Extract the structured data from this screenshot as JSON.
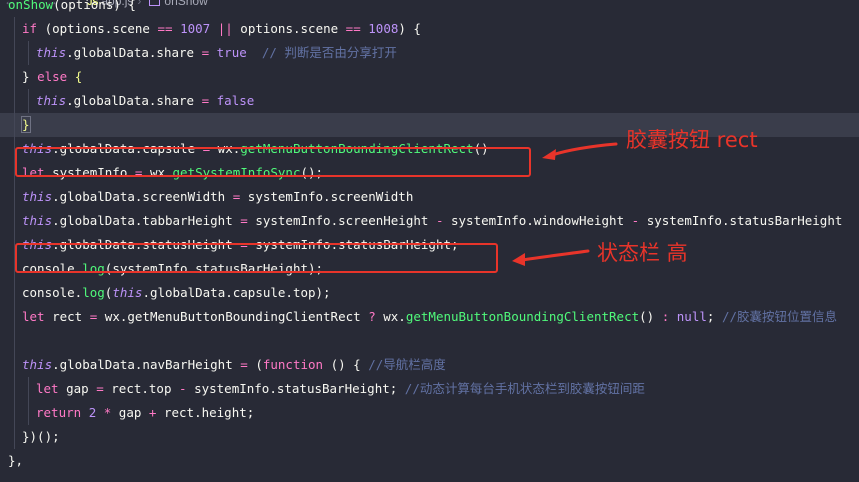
{
  "breadcrumb": {
    "file": "app.js",
    "symbol": "onShow",
    "js_badge": "JS"
  },
  "code_lines": [
    {
      "indent": 0,
      "hl": false,
      "tokens": [
        [
          "fn",
          "onShow"
        ],
        [
          "txt",
          "(options) {"
        ]
      ]
    },
    {
      "indent": 1,
      "hl": false,
      "tokens": [
        [
          "kw",
          "if"
        ],
        [
          "txt",
          " (options.scene "
        ],
        [
          "op",
          "=="
        ],
        [
          "txt",
          " "
        ],
        [
          "num",
          "1007"
        ],
        [
          "txt",
          " "
        ],
        [
          "op",
          "||"
        ],
        [
          "txt",
          " options.scene "
        ],
        [
          "op",
          "=="
        ],
        [
          "txt",
          " "
        ],
        [
          "num",
          "1008"
        ],
        [
          "txt",
          ") {"
        ]
      ]
    },
    {
      "indent": 2,
      "hl": false,
      "tokens": [
        [
          "this",
          "this"
        ],
        [
          "txt",
          ".globalData.share "
        ],
        [
          "op",
          "="
        ],
        [
          "txt",
          " "
        ],
        [
          "bool",
          "true"
        ],
        [
          "txt",
          "  "
        ],
        [
          "cm",
          "// 判断是否由分享打开"
        ]
      ]
    },
    {
      "indent": 1,
      "hl": false,
      "tokens": [
        [
          "txt",
          "} "
        ],
        [
          "kw",
          "else"
        ],
        [
          "txt",
          " "
        ],
        [
          "br",
          "{"
        ]
      ]
    },
    {
      "indent": 2,
      "hl": false,
      "tokens": [
        [
          "this",
          "this"
        ],
        [
          "txt",
          ".globalData.share "
        ],
        [
          "op",
          "="
        ],
        [
          "txt",
          " "
        ],
        [
          "bool",
          "false"
        ]
      ]
    },
    {
      "indent": 1,
      "hl": true,
      "tokens": [
        [
          "brm",
          "}"
        ]
      ]
    },
    {
      "indent": 1,
      "hl": false,
      "tokens": [
        [
          "this",
          "this"
        ],
        [
          "txt",
          ".globalData.capsule "
        ],
        [
          "op",
          "="
        ],
        [
          "txt",
          " wx."
        ],
        [
          "fn",
          "getMenuButtonBoundingClientRect"
        ],
        [
          "txt",
          "()"
        ]
      ]
    },
    {
      "indent": 1,
      "hl": false,
      "tokens": [
        [
          "kw",
          "let"
        ],
        [
          "txt",
          " systemInfo "
        ],
        [
          "op",
          "="
        ],
        [
          "txt",
          " wx."
        ],
        [
          "fn",
          "getSystemInfoSync"
        ],
        [
          "txt",
          "();"
        ]
      ]
    },
    {
      "indent": 1,
      "hl": false,
      "tokens": [
        [
          "this",
          "this"
        ],
        [
          "txt",
          ".globalData.screenWidth "
        ],
        [
          "op",
          "="
        ],
        [
          "txt",
          " systemInfo.screenWidth"
        ]
      ]
    },
    {
      "indent": 1,
      "hl": false,
      "tokens": [
        [
          "this",
          "this"
        ],
        [
          "txt",
          ".globalData.tabbarHeight "
        ],
        [
          "op",
          "="
        ],
        [
          "txt",
          " systemInfo.screenHeight "
        ],
        [
          "op",
          "-"
        ],
        [
          "txt",
          " systemInfo.windowHeight "
        ],
        [
          "op",
          "-"
        ],
        [
          "txt",
          " systemInfo.statusBarHeight"
        ]
      ]
    },
    {
      "indent": 1,
      "hl": false,
      "tokens": [
        [
          "this",
          "this"
        ],
        [
          "txt",
          ".globalData.statusHeight "
        ],
        [
          "op",
          "="
        ],
        [
          "txt",
          " systemInfo.statusBarHeight;"
        ]
      ]
    },
    {
      "indent": 1,
      "hl": false,
      "tokens": [
        [
          "txt",
          "console."
        ],
        [
          "fn",
          "log"
        ],
        [
          "txt",
          "(systemInfo.statusBarHeight);"
        ]
      ]
    },
    {
      "indent": 1,
      "hl": false,
      "tokens": [
        [
          "txt",
          "console."
        ],
        [
          "fn",
          "log"
        ],
        [
          "txt",
          "("
        ],
        [
          "this",
          "this"
        ],
        [
          "txt",
          ".globalData.capsule.top);"
        ]
      ]
    },
    {
      "indent": 1,
      "hl": false,
      "tokens": [
        [
          "kw",
          "let"
        ],
        [
          "txt",
          " rect "
        ],
        [
          "op",
          "="
        ],
        [
          "txt",
          " wx.getMenuButtonBoundingClientRect "
        ],
        [
          "op",
          "?"
        ],
        [
          "txt",
          " wx."
        ],
        [
          "fn",
          "getMenuButtonBoundingClientRect"
        ],
        [
          "txt",
          "() "
        ],
        [
          "op",
          ":"
        ],
        [
          "txt",
          " "
        ],
        [
          "bool",
          "null"
        ],
        [
          "txt",
          "; "
        ],
        [
          "cm",
          "//胶囊按钮位置信息"
        ]
      ]
    },
    {
      "indent": 1,
      "hl": false,
      "tokens": []
    },
    {
      "indent": 1,
      "hl": false,
      "tokens": [
        [
          "this",
          "this"
        ],
        [
          "txt",
          ".globalData.navBarHeight "
        ],
        [
          "op",
          "="
        ],
        [
          "txt",
          " ("
        ],
        [
          "kw",
          "function"
        ],
        [
          "txt",
          " () { "
        ],
        [
          "cm",
          "//导航栏高度"
        ]
      ]
    },
    {
      "indent": 2,
      "hl": false,
      "tokens": [
        [
          "kw",
          "let"
        ],
        [
          "txt",
          " gap "
        ],
        [
          "op",
          "="
        ],
        [
          "txt",
          " rect.top "
        ],
        [
          "op",
          "-"
        ],
        [
          "txt",
          " systemInfo.statusBarHeight; "
        ],
        [
          "cm",
          "//动态计算每台手机状态栏到胶囊按钮间距"
        ]
      ]
    },
    {
      "indent": 2,
      "hl": false,
      "tokens": [
        [
          "kw",
          "return"
        ],
        [
          "txt",
          " "
        ],
        [
          "num",
          "2"
        ],
        [
          "txt",
          " "
        ],
        [
          "op",
          "*"
        ],
        [
          "txt",
          " gap "
        ],
        [
          "op",
          "+"
        ],
        [
          "txt",
          " rect.height;"
        ]
      ]
    },
    {
      "indent": 1,
      "hl": false,
      "tokens": [
        [
          "txt",
          "})();"
        ]
      ]
    },
    {
      "indent": 0,
      "hl": false,
      "tokens": [
        [
          "txt",
          "},"
        ]
      ]
    }
  ],
  "annotations": {
    "capsule_label": "胶囊按钮 rect",
    "status_label": "状态栏 高"
  },
  "colors": {
    "background": "#282a36",
    "annotation_red": "#e8342a"
  }
}
